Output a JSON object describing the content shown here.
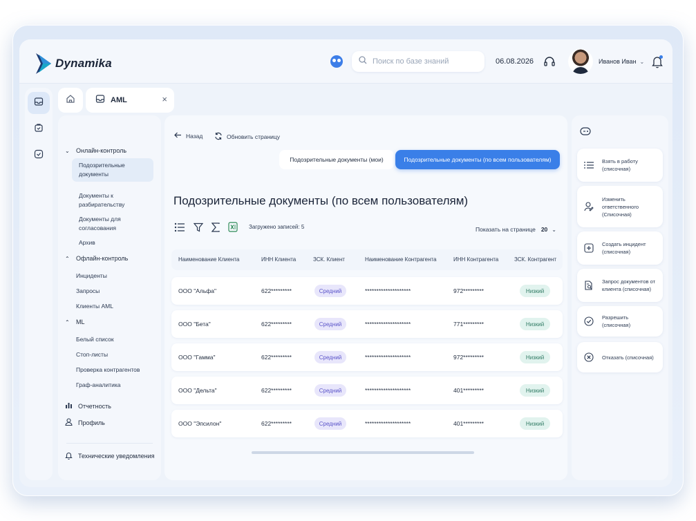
{
  "app": {
    "name": "Dynamika"
  },
  "header": {
    "search_placeholder": "Поиск по базе знаний",
    "date": "06.08.2026",
    "user_name": "Иванов Иван"
  },
  "tabs": {
    "active": "AML",
    "close": "×"
  },
  "sidebar": {
    "online": {
      "label": "Онлайн-контроль",
      "items": [
        "Подозрительные документы",
        "Документы к разбирательству",
        "Документы для согласования",
        "Архив"
      ]
    },
    "offline": {
      "label": "Офлайн-контроль",
      "items": [
        "Инциденты",
        "Запросы",
        "Клиенты AML"
      ]
    },
    "ml": {
      "label": "ML",
      "items": [
        "Белый список",
        "Стоп-листы",
        "Проверка контрагентов",
        "Граф-аналитика"
      ]
    },
    "reports": "Отчетность",
    "profile": "Профиль",
    "notifications": "Технические уведомления"
  },
  "main": {
    "back": "Назад",
    "refresh": "Обновить страницу",
    "segments": [
      "Подозрительные документы (мои)",
      "Подозрительные документы (по всем пользователям)"
    ],
    "title": "Подозрительные документы (по всем пользователям)",
    "loaded_label": "Загружено записей:",
    "loaded_count": "5",
    "per_page_label": "Показать на странице",
    "per_page_value": "20",
    "columns": [
      "Наименование Клиента",
      "ИНН Клиента",
      "ЗСК. Клиент",
      "Наименование Контрагента",
      "ИНН Контрагента",
      "ЗСК. Контрагент"
    ],
    "rows": [
      [
        "ООО \"Альфа\"",
        "622*********",
        "Средний",
        "********************",
        "972*********",
        "Низкий"
      ],
      [
        "ООО \"Бета\"",
        "622*********",
        "Средний",
        "********************",
        "771*********",
        "Низкий"
      ],
      [
        "ООО \"Гамма\"",
        "622*********",
        "Средний",
        "********************",
        "972*********",
        "Низкий"
      ],
      [
        "ООО \"Дельта\"",
        "622*********",
        "Средний",
        "********************",
        "401*********",
        "Низкий"
      ],
      [
        "ООО \"Эпсилон\"",
        "622*********",
        "Средний",
        "********************",
        "401*********",
        "Низкий"
      ]
    ]
  },
  "actions": [
    "Взять в работу (списочная)",
    "Изменить ответственного (Списочная)",
    "Создать инцидент (списочная)",
    "Запрос документов от клиента (списочная)",
    "Разрешить (списочная)",
    "Отказать (списочная)"
  ],
  "colors": {
    "accent": "#3a7fe8",
    "badge_mid": "#5b54c9",
    "badge_low": "#2f7a63",
    "background": "#eef3fa"
  }
}
